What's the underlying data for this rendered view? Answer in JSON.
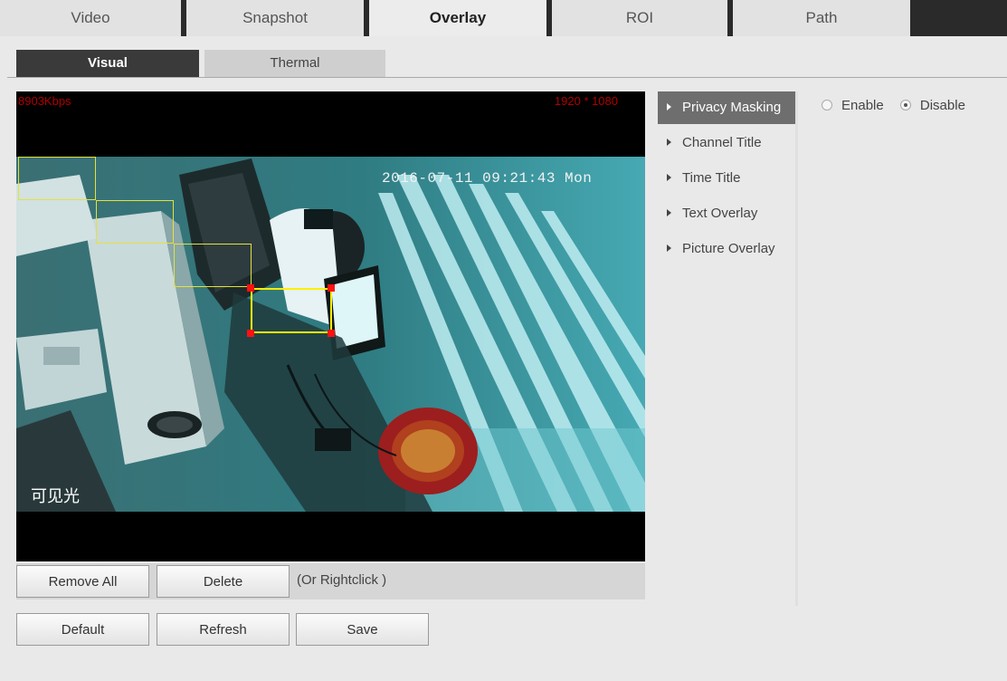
{
  "top_tabs": [
    {
      "label": "Video",
      "active": false
    },
    {
      "label": "Snapshot",
      "active": false
    },
    {
      "label": "Overlay",
      "active": true
    },
    {
      "label": "ROI",
      "active": false
    },
    {
      "label": "Path",
      "active": false
    }
  ],
  "sub_tabs": [
    {
      "label": "Visual",
      "active": true
    },
    {
      "label": "Thermal",
      "active": false
    }
  ],
  "video": {
    "bitrate": "8903Kbps",
    "resolution": "1920 * 1080",
    "timestamp": "2016-07-11 09:21:43 Mon",
    "channel_name": "可见光"
  },
  "actions": {
    "remove_all": "Remove All",
    "delete": "Delete",
    "hint": "(Or Rightclick )"
  },
  "footer": {
    "default": "Default",
    "refresh": "Refresh",
    "save": "Save"
  },
  "side_menu": [
    {
      "label": "Privacy Masking",
      "active": true
    },
    {
      "label": "Channel Title",
      "active": false
    },
    {
      "label": "Time Title",
      "active": false
    },
    {
      "label": "Text Overlay",
      "active": false
    },
    {
      "label": "Picture Overlay",
      "active": false
    }
  ],
  "privacy": {
    "enable_label": "Enable",
    "disable_label": "Disable",
    "selected": "Disable"
  },
  "colors": {
    "mask_border": "#e4e13a",
    "handle": "#ff1111",
    "osd_red": "#b00000"
  }
}
